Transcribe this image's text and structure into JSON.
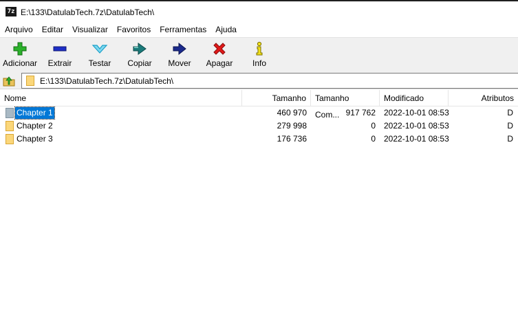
{
  "app_icon_text": "7z",
  "window_title": "E:\\133\\DatulabTech.7z\\DatulabTech\\",
  "menu": [
    "Arquivo",
    "Editar",
    "Visualizar",
    "Favoritos",
    "Ferramentas",
    "Ajuda"
  ],
  "toolbar": {
    "add": "Adicionar",
    "extract": "Extrair",
    "test": "Testar",
    "copy": "Copiar",
    "move": "Mover",
    "delete": "Apagar",
    "info": "Info"
  },
  "address": "E:\\133\\DatulabTech.7z\\DatulabTech\\",
  "columns": {
    "name": "Nome",
    "size": "Tamanho",
    "packed": "Tamanho Com...",
    "modified": "Modificado",
    "attributes": "Atributos"
  },
  "rows": [
    {
      "name": "Chapter 1",
      "size": "460 970",
      "packed": "917 762",
      "modified": "2022-10-01 08:53",
      "attributes": "D",
      "selected": true
    },
    {
      "name": "Chapter 2",
      "size": "279 998",
      "packed": "0",
      "modified": "2022-10-01 08:53",
      "attributes": "D",
      "selected": false
    },
    {
      "name": "Chapter 3",
      "size": "176 736",
      "packed": "0",
      "modified": "2022-10-01 08:53",
      "attributes": "D",
      "selected": false
    }
  ],
  "colors": {
    "add_green": "#2bb12b",
    "extract_blue": "#1d2ec7",
    "test_cyan": "#1aa0c8",
    "copy_teal": "#1a7a7a",
    "move_navy": "#1b2a8c",
    "delete_red": "#e01919",
    "info_yellow": "#f2e11b",
    "selection": "#0078d7"
  }
}
